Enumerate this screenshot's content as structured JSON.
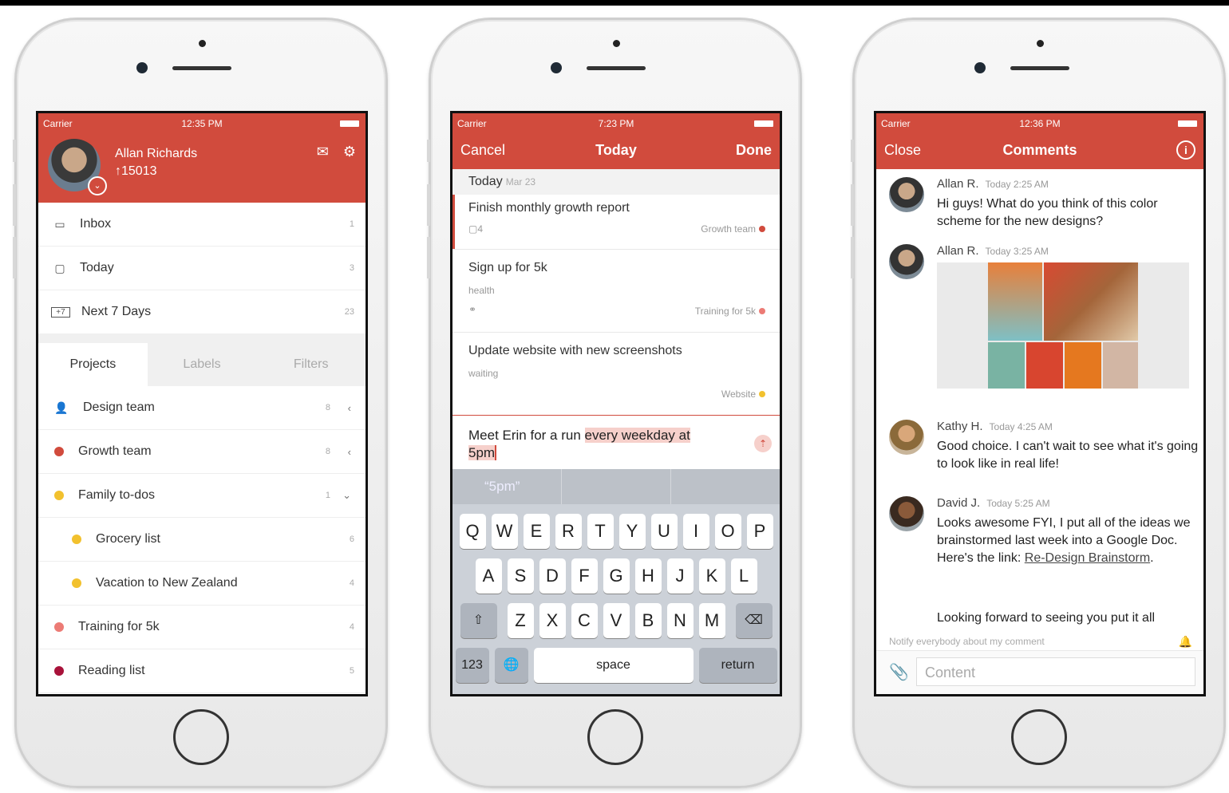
{
  "phone1": {
    "status": {
      "carrier": "Carrier",
      "time": "12:35 PM"
    },
    "user": {
      "name": "Allan Richards",
      "karma": "↑15013"
    },
    "nav": [
      {
        "label": "Inbox",
        "count": "1"
      },
      {
        "label": "Today",
        "count": "3"
      },
      {
        "label": "Next 7 Days",
        "count": "23"
      }
    ],
    "tabs": [
      "Projects",
      "Labels",
      "Filters"
    ],
    "projects": [
      {
        "label": "Design team",
        "count": "8",
        "color": "#e05a4a"
      },
      {
        "label": "Growth team",
        "count": "8",
        "color": "#d14b3d"
      },
      {
        "label": "Family to-dos",
        "count": "1",
        "color": "#f2c12e"
      },
      {
        "label": "Grocery list",
        "count": "6",
        "color": "#f2c12e"
      },
      {
        "label": "Vacation to New Zealand",
        "count": "4",
        "color": "#f2c12e"
      },
      {
        "label": "Training for 5k",
        "count": "4",
        "color": "#ec7b75"
      },
      {
        "label": "Reading list",
        "count": "5",
        "color": "#a8123a"
      }
    ]
  },
  "phone2": {
    "status": {
      "carrier": "Carrier",
      "time": "7:23 PM"
    },
    "nav": {
      "cancel": "Cancel",
      "title": "Today",
      "done": "Done"
    },
    "day": {
      "label": "Today",
      "date": "Mar 23"
    },
    "tasks": [
      {
        "title": "Finish monthly growth report",
        "sub": "▢4",
        "project": "Growth team",
        "color": "#d14b3d"
      },
      {
        "title": "Sign up for 5k",
        "sub": "health",
        "project": "Training for 5k",
        "color": "#ec7b75"
      },
      {
        "title": "Update website with new screenshots",
        "sub": "waiting",
        "project": "Website",
        "color": "#f2c12e"
      }
    ],
    "input": {
      "plain": "Meet Erin for a run ",
      "highlight1": "every weekday at",
      "highlight2": "5pm"
    },
    "suggestion": "“5pm”",
    "keys": {
      "row1": [
        "Q",
        "W",
        "E",
        "R",
        "T",
        "Y",
        "U",
        "I",
        "O",
        "P"
      ],
      "row2": [
        "A",
        "S",
        "D",
        "F",
        "G",
        "H",
        "J",
        "K",
        "L"
      ],
      "row3": [
        "Z",
        "X",
        "C",
        "V",
        "B",
        "N",
        "M"
      ],
      "num": "123",
      "space": "space",
      "return": "return"
    }
  },
  "phone3": {
    "status": {
      "carrier": "Carrier",
      "time": "12:36 PM"
    },
    "nav": {
      "close": "Close",
      "title": "Comments"
    },
    "comments": [
      {
        "author": "Allan R.",
        "time": "Today 2:25 AM",
        "text": "Hi guys! What do you think of this color scheme for the new designs?"
      },
      {
        "author": "Allan R.",
        "time": "Today 3:25 AM",
        "text": ""
      },
      {
        "author": "Kathy H.",
        "time": "Today 4:25 AM",
        "text": "Good choice. I can't wait to see what it's going to look like in real life!"
      },
      {
        "author": "David J.",
        "time": "Today 5:25 AM",
        "text": "Looks awesome FYI, I put all of the ideas we brainstormed last week into a Google Doc. Here's the link: ",
        "link": "Re-Design Brainstorm",
        "after": "."
      },
      {
        "author": "",
        "time": "",
        "text": "Looking forward to seeing you put it all"
      }
    ],
    "notify": "Notify everybody about my comment",
    "placeholder": "Content",
    "swatches": [
      "#79b3a3",
      "#d8452f",
      "#e5781f",
      "#d2b6a4"
    ]
  }
}
